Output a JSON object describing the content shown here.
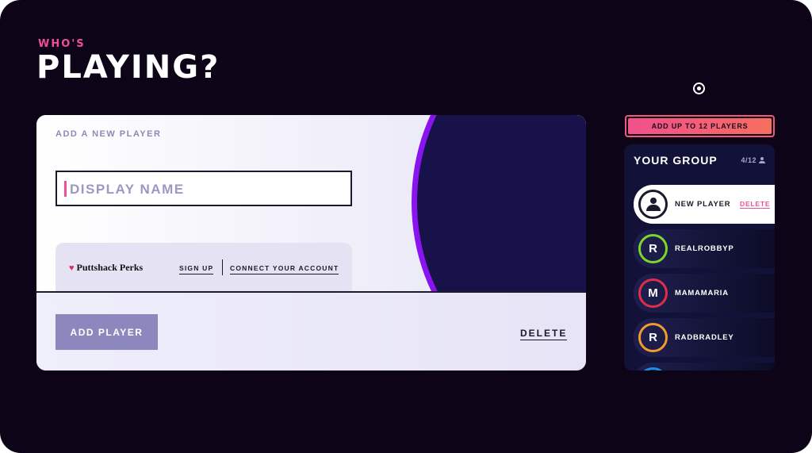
{
  "header": {
    "kicker": "WHO'S",
    "title": "PLAYING?"
  },
  "add_player": {
    "section_label": "ADD A NEW PLAYER",
    "name_placeholder": "DISPLAY NAME",
    "perks": {
      "brand": "Puttshack Perks",
      "sign_up": "SIGN UP",
      "connect": "CONNECT YOUR ACCOUNT"
    },
    "add_button": "ADD PLAYER",
    "delete_link": "DELETE"
  },
  "group": {
    "banner": "ADD UP TO 12 PLAYERS",
    "title": "YOUR GROUP",
    "count": "4/12",
    "players": [
      {
        "name": "NEW PLAYER",
        "initial": "",
        "ring_color": "#1a1a2c",
        "active": true,
        "action": "DELETE"
      },
      {
        "name": "REALROBBYP",
        "initial": "R",
        "ring_color": "#7ed62b",
        "active": false
      },
      {
        "name": "MAMAMARIA",
        "initial": "M",
        "ring_color": "#e02e49",
        "active": false
      },
      {
        "name": "RADBRADLEY",
        "initial": "R",
        "ring_color": "#f29a2c",
        "active": false
      },
      {
        "name": "",
        "initial": "",
        "ring_color": "#1e8de8",
        "active": false
      }
    ]
  },
  "colors": {
    "accent_pink": "#ee4f9b",
    "art_purple": "#8a14f0",
    "navy": "#17134a",
    "background": "#0e0418"
  }
}
